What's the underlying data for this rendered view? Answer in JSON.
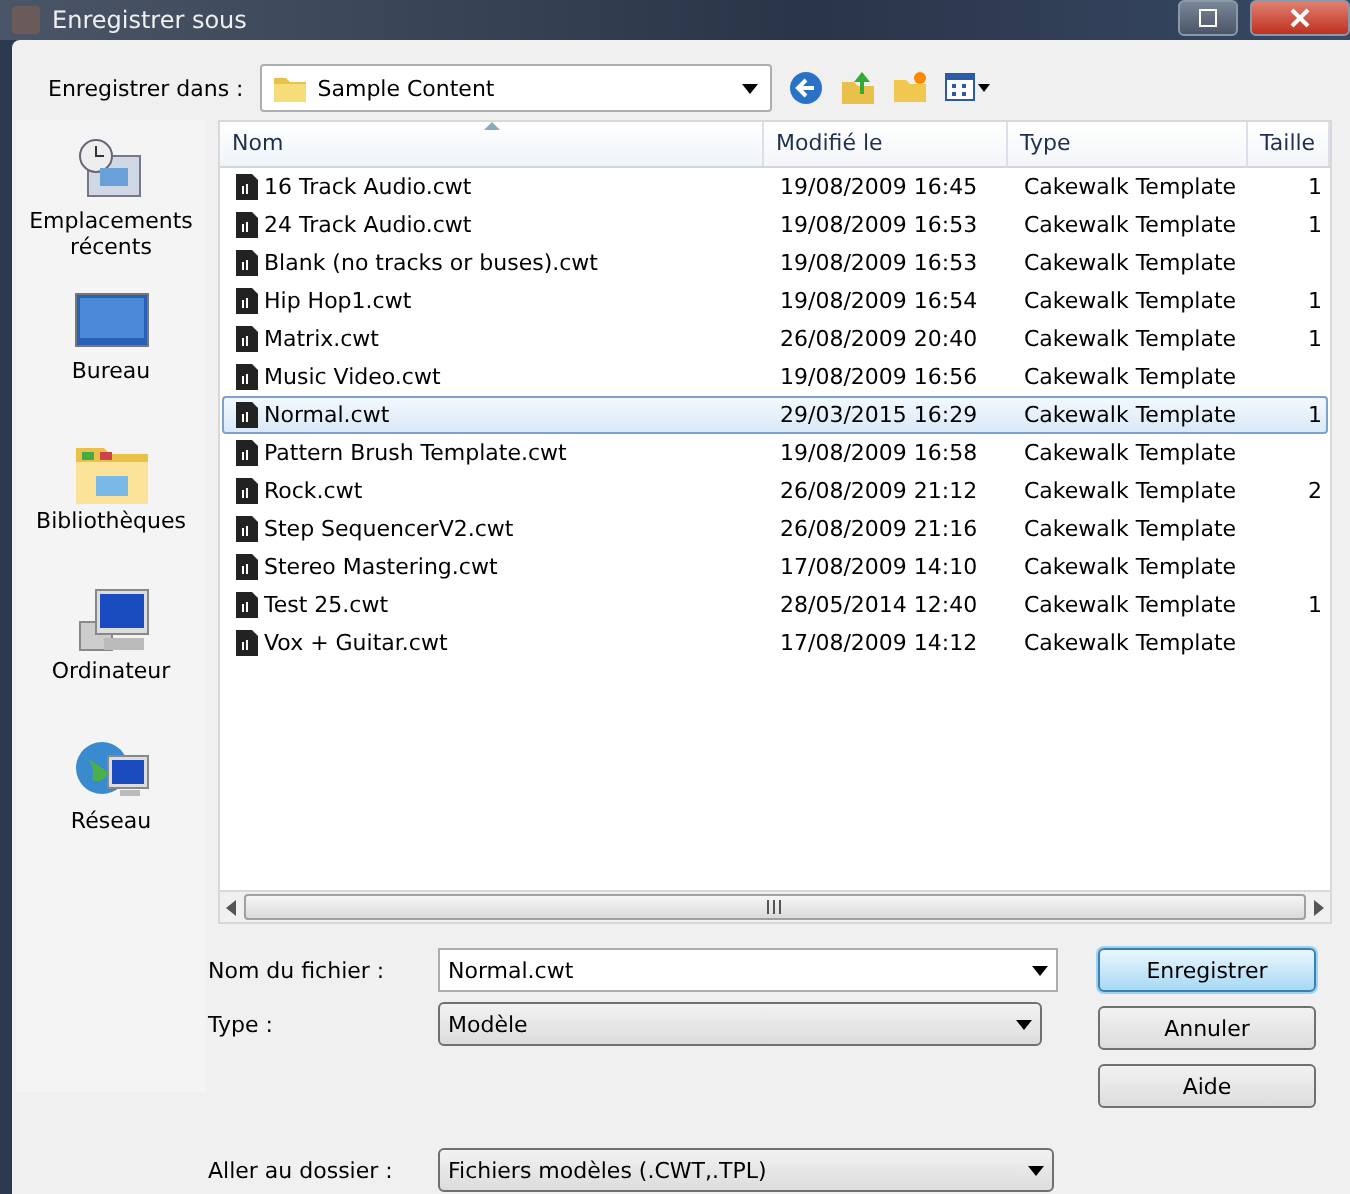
{
  "window": {
    "title": "Enregistrer sous"
  },
  "location": {
    "label": "Enregistrer dans :",
    "value": "Sample Content"
  },
  "sidebar": {
    "items": [
      {
        "label": "Emplacements récents",
        "kind": "recent",
        "selected": false
      },
      {
        "label": "Bureau",
        "kind": "desktop",
        "selected": false
      },
      {
        "label": "Bibliothèques",
        "kind": "libraries",
        "selected": false
      },
      {
        "label": "Ordinateur",
        "kind": "computer",
        "selected": false
      },
      {
        "label": "Réseau",
        "kind": "network",
        "selected": false
      }
    ]
  },
  "table": {
    "columns": [
      {
        "label": "Nom",
        "sorted": true
      },
      {
        "label": "Modifié le",
        "sorted": false
      },
      {
        "label": "Type",
        "sorted": false
      },
      {
        "label": "Taille",
        "sorted": false
      }
    ],
    "rows": [
      {
        "name": "16 Track Audio.cwt",
        "modified": "19/08/2009 16:45",
        "type": "Cakewalk Template",
        "size": "1",
        "selected": false
      },
      {
        "name": "24 Track Audio.cwt",
        "modified": "19/08/2009 16:53",
        "type": "Cakewalk Template",
        "size": "1",
        "selected": false
      },
      {
        "name": "Blank (no tracks or buses).cwt",
        "modified": "19/08/2009 16:53",
        "type": "Cakewalk Template",
        "selected": false
      },
      {
        "name": "Hip Hop1.cwt",
        "modified": "19/08/2009 16:54",
        "type": "Cakewalk Template",
        "size": "1",
        "selected": false
      },
      {
        "name": "Matrix.cwt",
        "modified": "26/08/2009 20:40",
        "type": "Cakewalk Template",
        "size": "1",
        "selected": false
      },
      {
        "name": "Music Video.cwt",
        "modified": "19/08/2009 16:56",
        "type": "Cakewalk Template",
        "selected": false
      },
      {
        "name": "Normal.cwt",
        "modified": "29/03/2015 16:29",
        "type": "Cakewalk Template",
        "size": "1",
        "selected": true
      },
      {
        "name": "Pattern Brush Template.cwt",
        "modified": "19/08/2009 16:58",
        "type": "Cakewalk Template",
        "selected": false
      },
      {
        "name": "Rock.cwt",
        "modified": "26/08/2009 21:12",
        "type": "Cakewalk Template",
        "size": "2",
        "selected": false
      },
      {
        "name": "Step SequencerV2.cwt",
        "modified": "26/08/2009 21:16",
        "type": "Cakewalk Template",
        "selected": false
      },
      {
        "name": "Stereo Mastering.cwt",
        "modified": "17/08/2009 14:10",
        "type": "Cakewalk Template",
        "selected": false
      },
      {
        "name": "Test 25.cwt",
        "modified": "28/05/2014 12:40",
        "type": "Cakewalk Template",
        "size": "1",
        "selected": false
      },
      {
        "name": "Vox + Guitar.cwt",
        "modified": "17/08/2009 14:12",
        "type": "Cakewalk Template",
        "selected": false
      }
    ]
  },
  "form": {
    "filename": {
      "label": "Nom du fichier :",
      "value": "Normal.cwt"
    },
    "type": {
      "label": "Type :",
      "value": "Modèle"
    },
    "folder": {
      "label": "Aller au dossier :",
      "value": "Fichiers modèles (.CWT,.TPL)"
    }
  },
  "buttons": [
    {
      "label": "Enregistrer",
      "default": true
    },
    {
      "label": "Annuler",
      "default": false
    },
    {
      "label": "Aide",
      "default": false
    }
  ]
}
